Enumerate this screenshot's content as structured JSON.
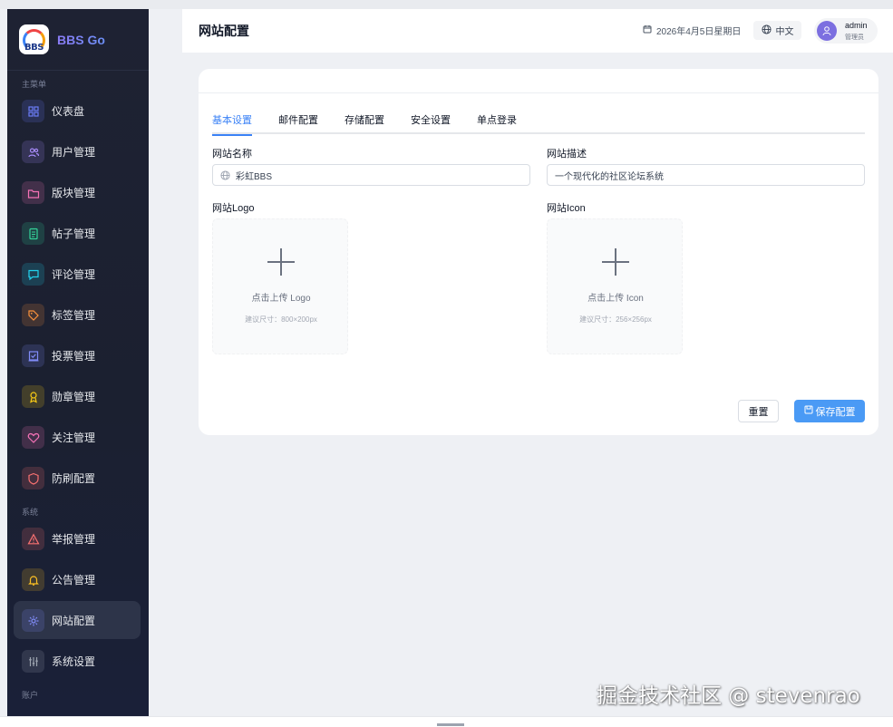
{
  "brand": {
    "logo_text": "BBS",
    "name": "BBS Go"
  },
  "sidebar": {
    "section_main": "主菜单",
    "section_system": "系统",
    "section_account": "账户",
    "items": [
      {
        "label": "仪表盘",
        "icon": "dashboard-icon",
        "color": "#6b7cf7"
      },
      {
        "label": "用户管理",
        "icon": "users-icon",
        "color": "#a78bfa"
      },
      {
        "label": "版块管理",
        "icon": "folder-icon",
        "color": "#f472b6"
      },
      {
        "label": "帖子管理",
        "icon": "document-icon",
        "color": "#34d399"
      },
      {
        "label": "评论管理",
        "icon": "comment-icon",
        "color": "#22d3ee"
      },
      {
        "label": "标签管理",
        "icon": "tag-icon",
        "color": "#fb923c"
      },
      {
        "label": "投票管理",
        "icon": "vote-icon",
        "color": "#818cf8"
      },
      {
        "label": "勋章管理",
        "icon": "medal-icon",
        "color": "#facc15"
      },
      {
        "label": "关注管理",
        "icon": "heart-icon",
        "color": "#f472b6"
      },
      {
        "label": "防刷配置",
        "icon": "shield-icon",
        "color": "#f87171"
      },
      {
        "label": "举报管理",
        "icon": "warning-icon",
        "color": "#f87171"
      },
      {
        "label": "公告管理",
        "icon": "bell-icon",
        "color": "#fbbf24"
      },
      {
        "label": "网站配置",
        "icon": "gear-icon",
        "color": "#818cf8"
      },
      {
        "label": "系统设置",
        "icon": "sliders-icon",
        "color": "#9ca3af"
      }
    ]
  },
  "header": {
    "title": "网站配置",
    "date": "2026年4月5日星期日",
    "language": "中文",
    "user_name": "admin",
    "user_role": "管理员"
  },
  "tabs": [
    "基本设置",
    "邮件配置",
    "存储配置",
    "安全设置",
    "单点登录"
  ],
  "form": {
    "site_name_label": "网站名称",
    "site_name_value": "彩虹BBS",
    "site_desc_label": "网站描述",
    "site_desc_value": "一个现代化的社区论坛系统",
    "logo_label": "网站Logo",
    "logo_upload_text": "点击上传 Logo",
    "logo_size_hint": "建议尺寸：800×200px",
    "icon_label": "网站Icon",
    "icon_upload_text": "点击上传 Icon",
    "icon_size_hint": "建议尺寸：256×256px",
    "reset_label": "重置",
    "save_label": "保存配置"
  },
  "watermark": "掘金技术社区 @ stevenrao",
  "colors": {
    "accent": "#3b82f6",
    "sidebar_bg": "#1e2233",
    "save_button": "#4a9af5"
  }
}
